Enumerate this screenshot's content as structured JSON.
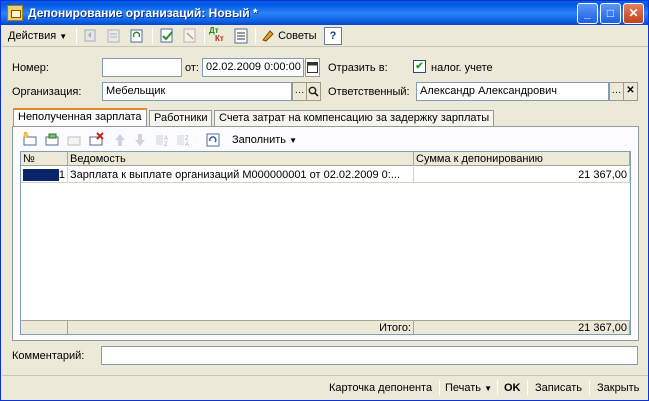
{
  "window": {
    "title": "Депонирование организаций: Новый *",
    "minimize_glyph": "_",
    "maximize_glyph": "□",
    "close_glyph": "✕"
  },
  "toolbar": {
    "actions_label": "Действия",
    "tips_label": "Советы",
    "help_glyph": "?",
    "dtkt_label_top": "Дт",
    "dtkt_label_bottom": "Кт"
  },
  "form": {
    "number_label": "Номер:",
    "number_value": "",
    "date_label": "от:",
    "date_value": "02.02.2009  0:00:00",
    "reflect_label": "Отразить в:",
    "tax_accounting_label": "налог. учете",
    "tax_accounting_checked": true,
    "organization_label": "Организация:",
    "organization_value": "Мебельщик",
    "responsible_label": "Ответственный:",
    "responsible_value": "Александр Александрович",
    "comment_label": "Комментарий:",
    "comment_value": ""
  },
  "tabs": [
    {
      "label": "Неполученная зарплата",
      "active": true
    },
    {
      "label": "Работники",
      "active": false
    },
    {
      "label": "Счета затрат на компенсацию за задержку зарплаты",
      "active": false
    }
  ],
  "panel_toolbar": {
    "fill_label": "Заполнить"
  },
  "table": {
    "columns": [
      "№",
      "Ведомость",
      "Сумма к депонированию"
    ],
    "rows": [
      {
        "n": "1",
        "statement": "Зарплата к выплате организаций М000000001 от 02.02.2009 0:...",
        "amount": "21 367,00"
      }
    ],
    "total_label": "Итого:",
    "total_value": "21 367,00"
  },
  "bottom": {
    "card_label": "Карточка депонента",
    "print_label": "Печать",
    "ok_label": "OK",
    "save_label": "Записать",
    "close_label": "Закрыть"
  },
  "colors": {
    "titlebar": "#0058e6",
    "accent_tab": "#e68b2c",
    "selection": "#0a246a"
  }
}
